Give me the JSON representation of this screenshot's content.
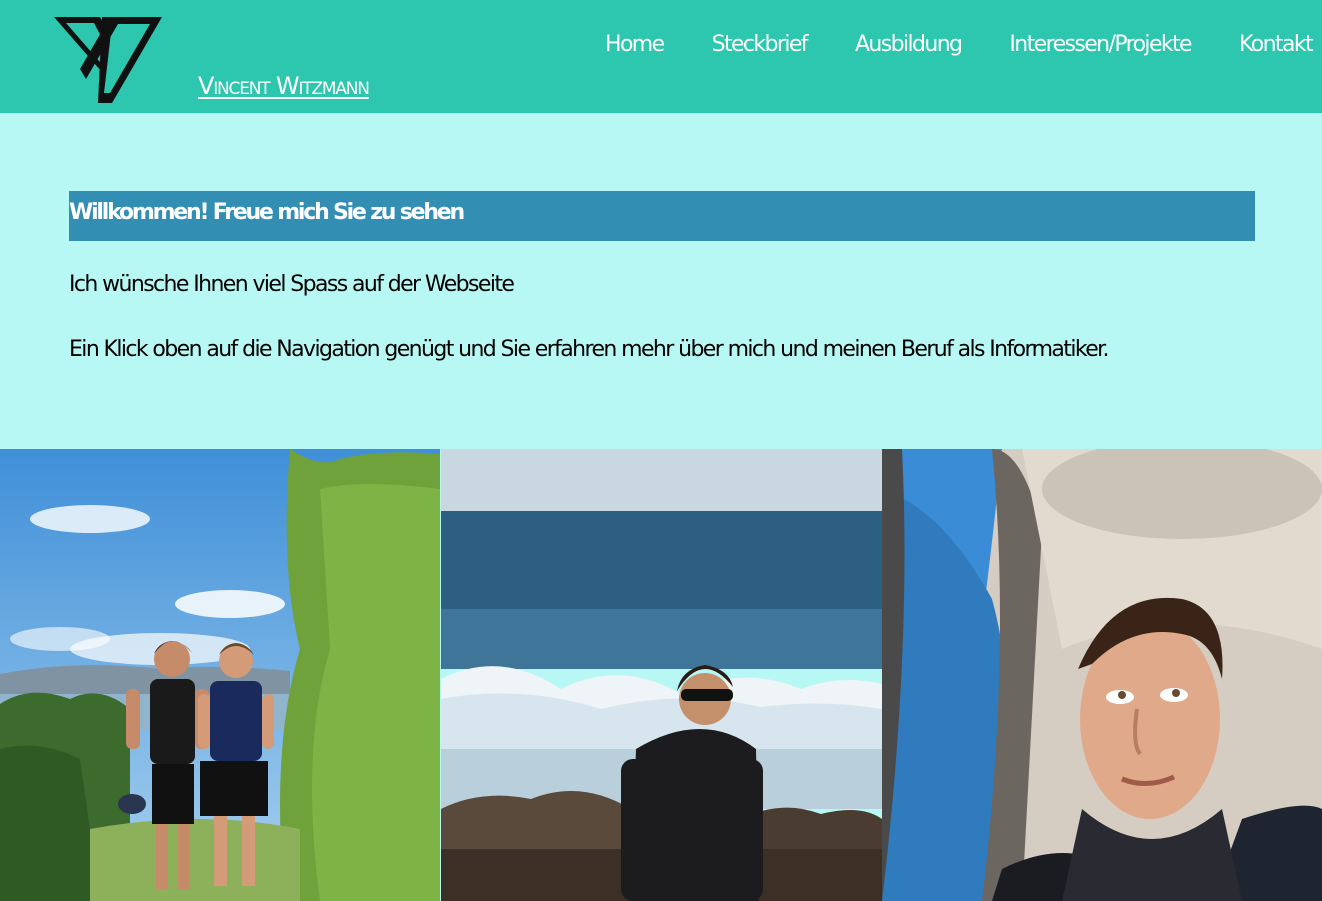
{
  "header": {
    "brand_name": "Vincent Witzmann",
    "logo_icon": "v-logo-icon",
    "colors": {
      "header_bg": "#2dc6ae",
      "page_bg": "#b7f8f4",
      "welcome_bar_bg": "#338eb3"
    }
  },
  "nav": {
    "items": [
      {
        "label": "Home"
      },
      {
        "label": "Steckbrief"
      },
      {
        "label": "Ausbildung"
      },
      {
        "label": "Interessen/Projekte"
      },
      {
        "label": "Kontakt"
      }
    ]
  },
  "main": {
    "welcome_title": "Willkommen! Freue mich Sie zu sehen",
    "paragraph_1": "Ich wünsche Ihnen viel Spass auf der Webseite",
    "paragraph_2": "Ein Klick oben auf die Navigation genügt und Sie erfahren mehr über mich und meinen Beruf als Informatiker."
  },
  "gallery": {
    "photos": [
      {
        "subject": "two-boys-coast-photo"
      },
      {
        "subject": "boy-ocean-waves-photo"
      },
      {
        "subject": "car-selfie-photo"
      }
    ]
  }
}
